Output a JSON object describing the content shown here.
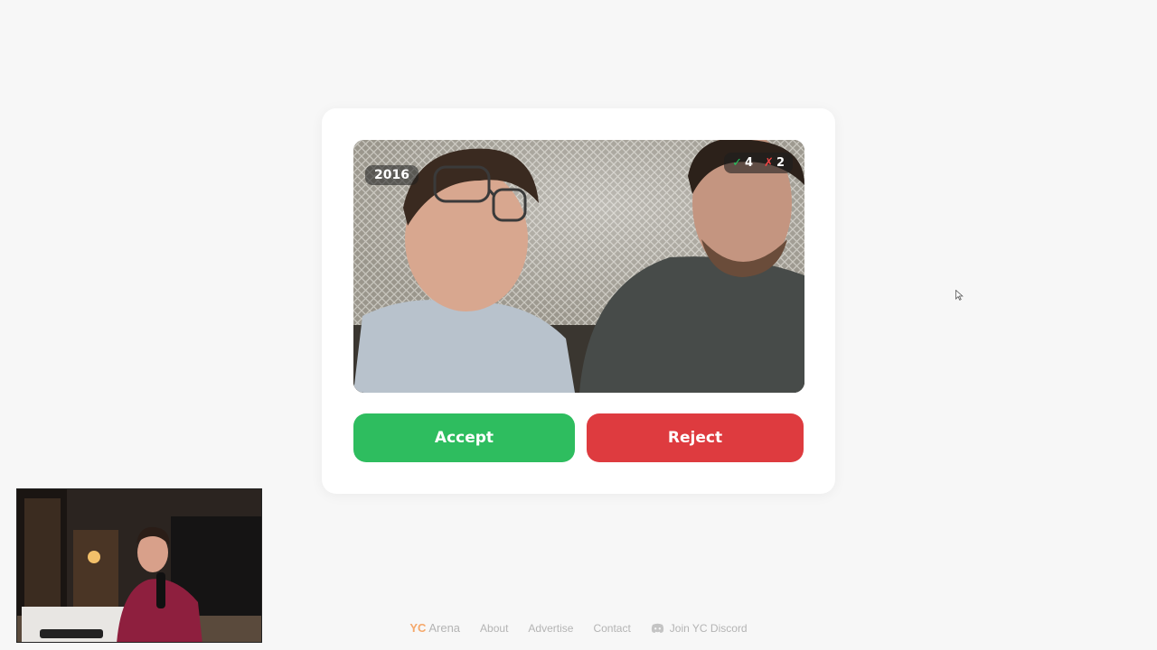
{
  "card": {
    "year": "2016",
    "accept_count": "4",
    "reject_count": "2",
    "accept_label": "Accept",
    "reject_label": "Reject",
    "check_glyph": "✓",
    "cross_glyph": "✗"
  },
  "footer": {
    "brand_prefix": "YC",
    "brand_name": "Arena",
    "links": [
      "About",
      "Advertise",
      "Contact"
    ],
    "discord_label": "Join YC Discord"
  },
  "icons": [
    "check-icon",
    "cross-icon",
    "discord-icon",
    "cursor-icon"
  ],
  "colors": {
    "accept": "#2ebd5f",
    "reject": "#de3b3f",
    "brand_yc": "#f5a86b",
    "background": "#f7f7f7"
  }
}
